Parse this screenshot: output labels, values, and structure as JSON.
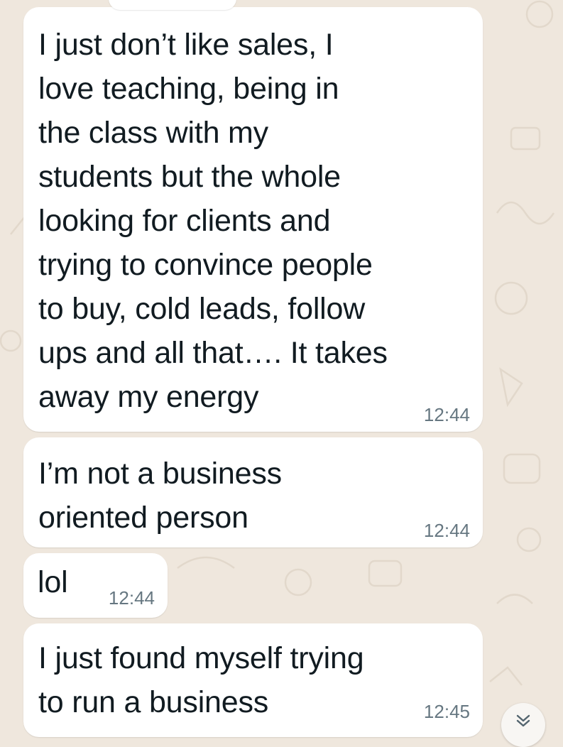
{
  "messages": [
    {
      "text": "I just don’t like sales, I\nlove teaching, being in\nthe class with my\nstudents but the whole\nlooking for clients and\ntrying to convince people\nto buy, cold leads, follow\nups and all that…. It takes\naway my energy",
      "time": "12:44"
    },
    {
      "text": "I’m not a business\noriented person",
      "time": "12:44"
    },
    {
      "text": "lol",
      "time": "12:44"
    },
    {
      "text": "I just found myself trying\nto run a business",
      "time": "12:45"
    }
  ],
  "scroll_button": {
    "icon": "chevron-down-double-icon"
  },
  "colors": {
    "wallpaper": "#efe7dd",
    "bubble": "#ffffff",
    "text": "#111b21",
    "timestamp": "#667781"
  }
}
